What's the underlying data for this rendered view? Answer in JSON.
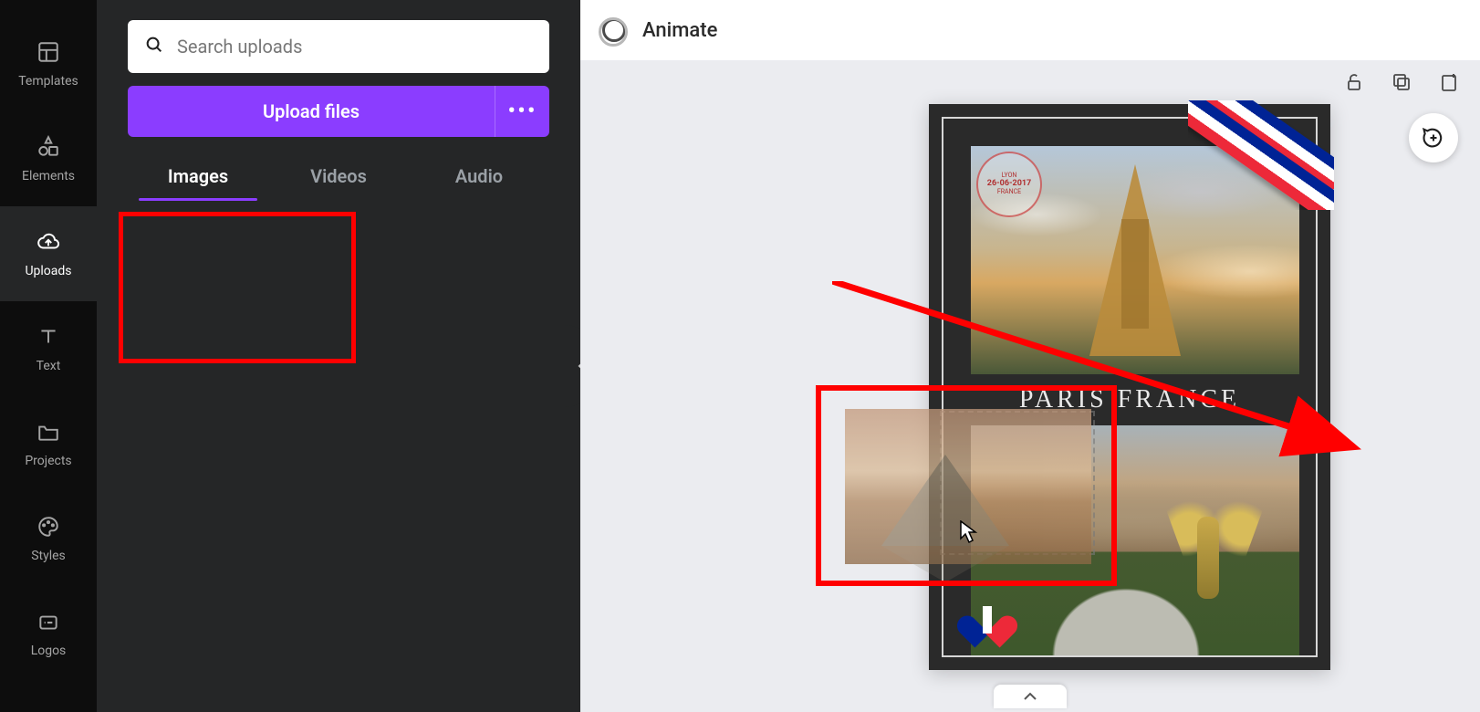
{
  "nav": {
    "items": [
      {
        "label": "Templates"
      },
      {
        "label": "Elements"
      },
      {
        "label": "Uploads"
      },
      {
        "label": "Text"
      },
      {
        "label": "Projects"
      },
      {
        "label": "Styles"
      },
      {
        "label": "Logos"
      }
    ],
    "active_index": 2
  },
  "search": {
    "placeholder": "Search uploads"
  },
  "upload": {
    "button_label": "Upload files",
    "more_label": "•••"
  },
  "tabs": {
    "items": [
      {
        "label": "Images"
      },
      {
        "label": "Videos"
      },
      {
        "label": "Audio"
      }
    ],
    "active_index": 0
  },
  "topbar": {
    "animate_label": "Animate"
  },
  "design": {
    "title_text": "PARIS  FRANCE",
    "stamp": {
      "top": "LYON",
      "date": "26-06-2017",
      "bottom": "FRANCE"
    }
  },
  "colors": {
    "accent": "#8b3dff",
    "annotation": "#ff0000"
  }
}
